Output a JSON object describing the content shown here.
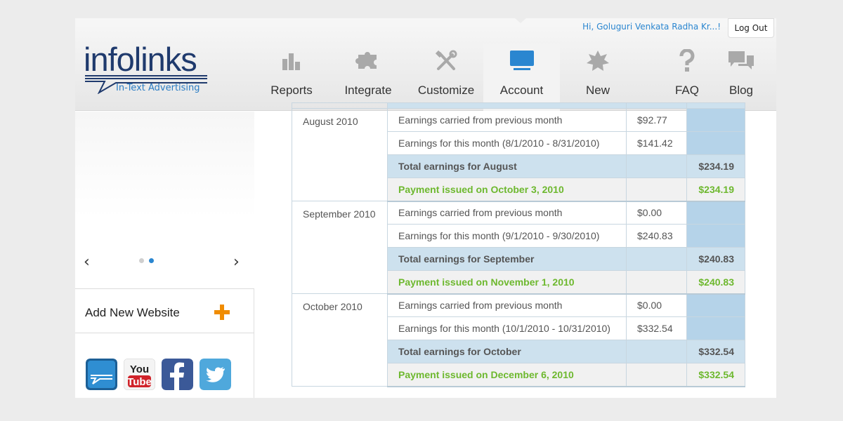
{
  "header": {
    "logo_text": "infolinks",
    "logo_tagline": "In-Text Advertising",
    "greeting": "Hi, Goluguri Venkata Radha Kr...!",
    "logout_label": "Log Out",
    "nav": [
      {
        "label": "Reports",
        "icon": "bar-chart-icon"
      },
      {
        "label": "Integrate",
        "icon": "puzzle-icon"
      },
      {
        "label": "Customize",
        "icon": "tools-icon"
      },
      {
        "label": "Account",
        "icon": "monitor-icon",
        "active": true
      },
      {
        "label": "New",
        "icon": "starburst-icon"
      },
      {
        "label": "FAQ",
        "icon": "question-icon"
      },
      {
        "label": "Blog",
        "icon": "chat-bubbles-icon"
      }
    ],
    "accent_color": "#2a86d0"
  },
  "sidebar": {
    "slider_prev": "‹",
    "slider_next": "›",
    "slider_pages": 2,
    "slider_active_page": 2,
    "add_website_label": "Add New Website",
    "social": [
      {
        "name": "infolinks",
        "icon": "infolinks-icon"
      },
      {
        "name": "YouTube",
        "text": "You Tube",
        "icon": "youtube-icon"
      },
      {
        "name": "Facebook",
        "icon": "facebook-icon"
      },
      {
        "name": "Twitter",
        "icon": "twitter-icon"
      }
    ]
  },
  "earnings": [
    {
      "month": "August 2010",
      "carried_label": "Earnings carried from previous month",
      "carried_amount": "$92.77",
      "this_month_label": "Earnings for this month (8/1/2010 - 8/31/2010)",
      "this_month_amount": "$141.42",
      "total_label": "Total earnings for August",
      "total_amount": "$234.19",
      "payment_label": "Payment issued on October 3, 2010",
      "payment_amount": "$234.19"
    },
    {
      "month": "September 2010",
      "carried_label": "Earnings carried from previous month",
      "carried_amount": "$0.00",
      "this_month_label": "Earnings for this month (9/1/2010 - 9/30/2010)",
      "this_month_amount": "$240.83",
      "total_label": "Total earnings for September",
      "total_amount": "$240.83",
      "payment_label": "Payment issued on November 1, 2010",
      "payment_amount": "$240.83"
    },
    {
      "month": "October 2010",
      "carried_label": "Earnings carried from previous month",
      "carried_amount": "$0.00",
      "this_month_label": "Earnings for this month (10/1/2010 - 10/31/2010)",
      "this_month_amount": "$332.54",
      "total_label": "Total earnings for October",
      "total_amount": "$332.54",
      "payment_label": "Payment issued on December 6, 2010",
      "payment_amount": "$332.54"
    }
  ],
  "colors": {
    "payment_green": "#6db82e",
    "total_row_blue": "#cde1ee",
    "total_col_blue": "#b5d3e9"
  }
}
